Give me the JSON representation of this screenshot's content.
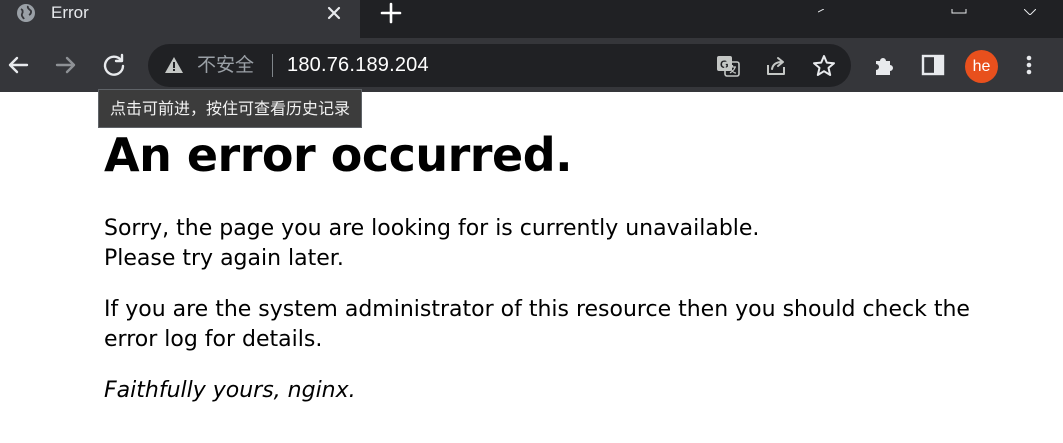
{
  "tab": {
    "title": "Error",
    "favicon_icon": "globe-icon",
    "close_icon": "close-icon",
    "new_tab_icon": "plus-icon"
  },
  "toolbar": {
    "back_icon": "arrow-left-icon",
    "forward_icon": "arrow-right-icon",
    "reload_icon": "reload-icon",
    "security_icon": "warning-triangle-icon",
    "security_label": "不安全",
    "url": "180.76.189.204",
    "translate_icon": "translate-icon",
    "share_icon": "share-icon",
    "bookmark_icon": "star-icon",
    "extensions_icon": "puzzle-icon",
    "sidepanel_icon": "side-panel-icon",
    "profile_initials": "he",
    "menu_icon": "kebab-menu-icon"
  },
  "tooltip": {
    "text": "点击可前进，按住可查看历史记录"
  },
  "page": {
    "heading": "An error occurred.",
    "paragraph1_line1": "Sorry, the page you are looking for is currently unavailable.",
    "paragraph1_line2": "Please try again later.",
    "paragraph2": "If you are the system administrator of this resource then you should check the error log for details.",
    "signature": "Faithfully yours, nginx."
  },
  "colors": {
    "avatar": "#e8501d",
    "chrome_dark": "#35363a",
    "omnibox": "#202124"
  }
}
